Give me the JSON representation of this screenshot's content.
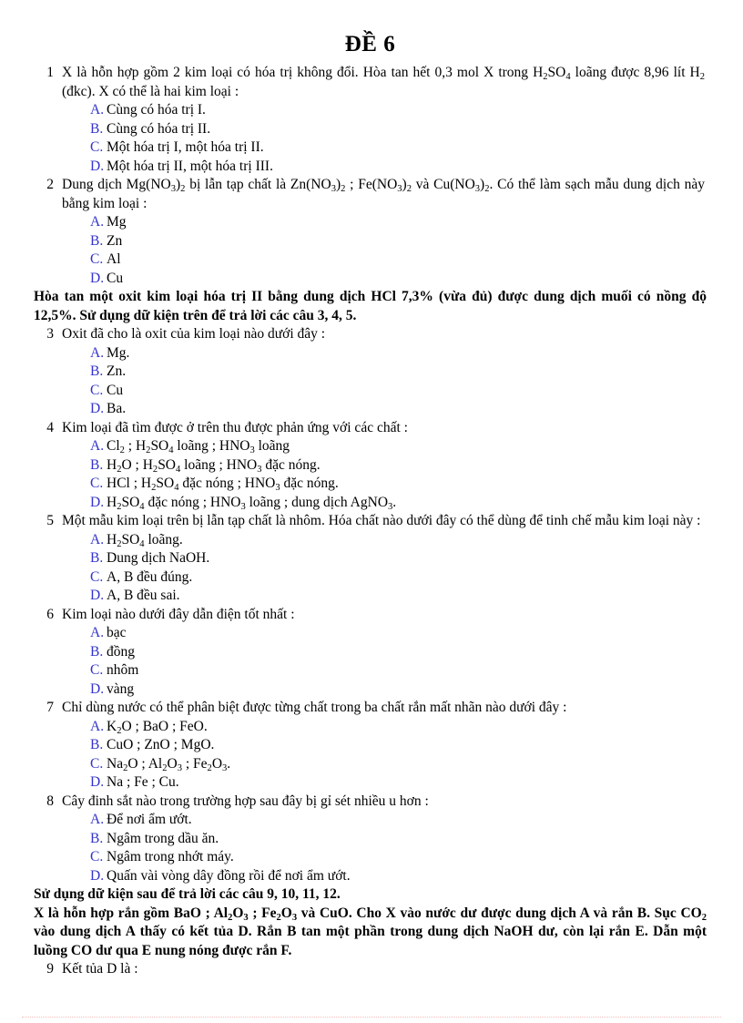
{
  "document": {
    "title": "ĐỀ 6",
    "accent_color": "#3333cc",
    "text_color": "#000000",
    "background_color": "#ffffff",
    "footer_rule_color": "#f0b3ae"
  },
  "blocks": [
    {
      "kind": "question",
      "number": "1",
      "text": "X là hỗn hợp gồm 2 kim loại có hóa trị không đổi. Hòa tan hết 0,3 mol X trong H2SO4 loãng được 8,96 lít H2 (đkc). X có thể là hai kim loại :",
      "options": [
        {
          "letter": "A.",
          "text": "Cùng có hóa trị I."
        },
        {
          "letter": "B.",
          "text": "Cùng có hóa trị II."
        },
        {
          "letter": "C.",
          "text": "Một hóa trị I, một hóa trị II."
        },
        {
          "letter": "D.",
          "text": "Một hóa trị II, một hóa trị III."
        }
      ]
    },
    {
      "kind": "question",
      "number": "2",
      "text": "Dung dịch Mg(NO3)2 bị lẫn tạp chất là Zn(NO3)2 ; Fe(NO3)2 và Cu(NO3)2. Có thể làm sạch mẫu dung dịch này bằng kim loại :",
      "options": [
        {
          "letter": "A.",
          "text": "Mg"
        },
        {
          "letter": "B.",
          "text": "Zn"
        },
        {
          "letter": "C.",
          "text": "Al"
        },
        {
          "letter": "D.",
          "text": "Cu"
        }
      ]
    },
    {
      "kind": "bold-paragraph",
      "text": "Hòa tan một oxit kim loại hóa trị II bằng dung dịch HCl 7,3% (vừa đủ) được dung dịch muối có nồng độ 12,5%. Sử dụng dữ kiện trên để trả lời các câu 3, 4, 5."
    },
    {
      "kind": "question",
      "number": "3",
      "text": "Oxit đã cho là oxit của kim loại nào dưới đây :",
      "options": [
        {
          "letter": "A.",
          "text": "Mg."
        },
        {
          "letter": "B.",
          "text": "Zn."
        },
        {
          "letter": "C.",
          "text": "Cu"
        },
        {
          "letter": "D.",
          "text": "Ba."
        }
      ]
    },
    {
      "kind": "question",
      "number": "4",
      "text": "Kim loại đã tìm được ở trên thu được phản ứng với các chất :",
      "options": [
        {
          "letter": "A.",
          "text": "Cl2 ; H2SO4 loãng ; HNO3 loãng"
        },
        {
          "letter": "B.",
          "text": "H2O ; H2SO4 loãng ; HNO3 đặc nóng."
        },
        {
          "letter": "C.",
          "text": "HCl ; H2SO4 đặc nóng ; HNO3 đặc nóng."
        },
        {
          "letter": "D.",
          "text": "H2SO4 đặc nóng ; HNO3 loãng ; dung dịch AgNO3."
        }
      ]
    },
    {
      "kind": "question",
      "number": "5",
      "text": "Một mẫu kim loại trên bị lẫn tạp chất là nhôm. Hóa chất nào dưới đây có thể dùng để tinh chế mẫu kim loại này :",
      "options": [
        {
          "letter": "A.",
          "text": "H2SO4 loãng."
        },
        {
          "letter": "B.",
          "text": "Dung dịch NaOH."
        },
        {
          "letter": "C.",
          "text": "A, B đều đúng."
        },
        {
          "letter": "D.",
          "text": "A, B đều sai."
        }
      ]
    },
    {
      "kind": "question",
      "number": "6",
      "text": "Kim loại nào dưới đây dẫn điện tốt nhất :",
      "options": [
        {
          "letter": "A.",
          "text": "bạc"
        },
        {
          "letter": "B.",
          "text": "đồng"
        },
        {
          "letter": "C.",
          "text": "nhôm"
        },
        {
          "letter": "D.",
          "text": "vàng"
        }
      ]
    },
    {
      "kind": "question",
      "number": "7",
      "text": "Chỉ dùng nước có thể phân biệt được từng chất trong ba chất rắn mất nhãn nào dưới đây :",
      "options": [
        {
          "letter": "A.",
          "text": "K2O ; BaO ; FeO."
        },
        {
          "letter": "B.",
          "text": "CuO ; ZnO ; MgO."
        },
        {
          "letter": "C.",
          "text": "Na2O ; Al2O3 ; Fe2O3."
        },
        {
          "letter": "D.",
          "text": "Na ; Fe ; Cu."
        }
      ]
    },
    {
      "kind": "question",
      "number": "8",
      "text": "Cây đinh sắt nào trong trường hợp sau đây bị gỉ sét nhiều u hơn :",
      "options": [
        {
          "letter": "A.",
          "text": "Để nơi ẩm ướt."
        },
        {
          "letter": "B.",
          "text": "Ngâm trong dầu ăn."
        },
        {
          "letter": "C.",
          "text": "Ngâm trong nhớt máy."
        },
        {
          "letter": "D.",
          "text": "Quấn vài vòng dây đồng rồi để nơi ẩm ướt."
        }
      ]
    },
    {
      "kind": "bold-paragraph",
      "text": "Sử dụng dữ kiện sau để trả lời các câu 9, 10, 11, 12."
    },
    {
      "kind": "bold-paragraph",
      "text": "X là hỗn hợp rắn gồm BaO ; Al2O3 ; Fe2O3 và CuO. Cho X vào nước dư được dung dịch A và rắn B. Sục CO2 vào dung dịch A thấy có kết tủa D. Rắn B tan một phần trong dung dịch NaOH dư, còn lại rắn E. Dẫn một luồng CO dư qua E nung nóng được rắn F."
    },
    {
      "kind": "question",
      "number": "9",
      "text": "Kết tủa D là :",
      "options": []
    }
  ]
}
